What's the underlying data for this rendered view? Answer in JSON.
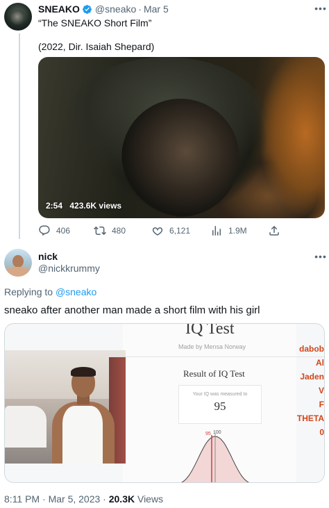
{
  "quoted_tweet": {
    "display_name": "SNEAKO",
    "handle": "@sneako",
    "separator": "·",
    "date": "Mar 5",
    "text": "“The SNEAKO Short Film”",
    "credit": "(2022, Dir. Isaiah Shepard)",
    "video": {
      "duration": "2:54",
      "views": "423.6K views"
    },
    "actions": {
      "replies": "406",
      "retweets": "480",
      "likes": "6,121",
      "views": "1.9M"
    }
  },
  "main_tweet": {
    "display_name": "nick",
    "handle": "@nickkrummy",
    "replying_prefix": "Replying to",
    "replying_to": "@sneako",
    "text": "sneako after another man made a short film with his girl",
    "media": {
      "iq_title": "IQ Test",
      "iq_subtitle": "Made by Mensa Norway",
      "iq_result_heading": "Result of IQ Test",
      "iq_measured_text": "Your IQ was measured to",
      "iq_score": "95",
      "bell_markers": [
        "95",
        "100"
      ],
      "side_text": [
        "dabob",
        "Al",
        "Jaden",
        "V",
        "F",
        "THETA",
        "0"
      ]
    },
    "footer": {
      "time": "8:11 PM",
      "date": "Mar 5, 2023",
      "views_count": "20.3K",
      "views_label": "Views"
    }
  },
  "colors": {
    "accent": "#1d9bf0",
    "muted": "#536471",
    "text": "#0f1419",
    "side_text": "#d1451a"
  },
  "icons": [
    "verified-badge-icon",
    "more-icon",
    "reply-icon",
    "retweet-icon",
    "like-icon",
    "views-icon",
    "share-icon"
  ]
}
